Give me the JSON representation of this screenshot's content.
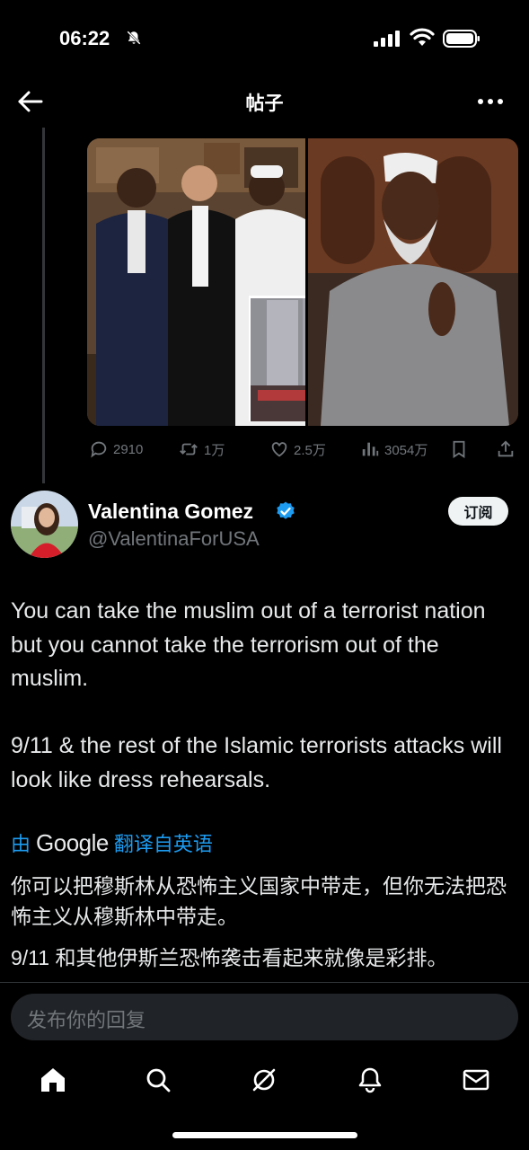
{
  "status_bar": {
    "time": "06:22",
    "icons": [
      "bell-slash-icon",
      "signal-icon",
      "wifi-icon",
      "battery-icon"
    ]
  },
  "top_bar": {
    "title": "帖子",
    "back_icon": "arrow-left-icon",
    "more_icon": "more-dots-icon"
  },
  "quoted_post": {
    "media": [
      "photo-group-portrait",
      "photo-man-in-white-cap",
      "photo-street-crowd"
    ],
    "actions": [
      {
        "icon": "reply-icon",
        "count": "2910"
      },
      {
        "icon": "retweet-icon",
        "count": "1万"
      },
      {
        "icon": "like-icon",
        "count": "2.5万"
      },
      {
        "icon": "views-icon",
        "count": "3054万"
      },
      {
        "icon": "bookmark-icon",
        "count": ""
      },
      {
        "icon": "share-icon",
        "count": ""
      }
    ]
  },
  "author": {
    "name": "Valentina Gomez",
    "handle": "@ValentinaForUSA",
    "verified": true,
    "subscribe_label": "订阅"
  },
  "post": {
    "paragraph1": "You can take the muslim out of a terrorist nation but you cannot take the terrorism out of the muslim.",
    "paragraph2": "9/11 & the rest of the Islamic terrorists attacks will look like dress rehearsals."
  },
  "translation": {
    "prefix": "由",
    "brand": "Google",
    "suffix": "翻译自英语",
    "zh1": "你可以把穆斯林从恐怖主义国家中带走，但你无法把恐怖主义从穆斯林中带走。",
    "zh2": "9/11 和其他伊斯兰恐怖袭击看起来就像是彩排。"
  },
  "reply_bar": {
    "placeholder": "发布你的回复"
  },
  "tab_bar": [
    "home-icon",
    "search-icon",
    "grok-icon",
    "notifications-icon",
    "messages-icon"
  ],
  "colors": {
    "background": "#000000",
    "text": "#e7e9ea",
    "secondary": "#71767b",
    "accent": "#1d9bf0"
  }
}
